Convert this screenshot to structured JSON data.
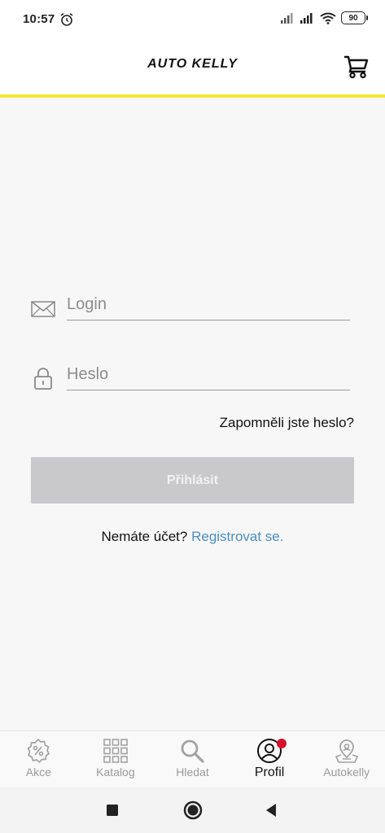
{
  "status_bar": {
    "time": "10:57",
    "battery": "90",
    "icons": [
      "alarm-icon",
      "signal-icon",
      "signal-icon",
      "wifi-icon",
      "battery-icon"
    ]
  },
  "header": {
    "brand": "AUTO KELLY",
    "cart_icon": "cart-icon",
    "accent_color": "#f4e92b"
  },
  "form": {
    "login_placeholder": "Login",
    "login_value": "",
    "password_placeholder": "Heslo",
    "password_value": "",
    "forgot_label": "Zapomněli jste heslo?",
    "submit_label": "Přihlásit",
    "no_account_text": "Nemáte účet?",
    "register_label": "Registrovat se."
  },
  "bottom_nav": {
    "items": [
      {
        "label": "Akce",
        "icon": "percent-badge-icon"
      },
      {
        "label": "Katalog",
        "icon": "grid-icon"
      },
      {
        "label": "Hledat",
        "icon": "search-icon"
      },
      {
        "label": "Profil",
        "icon": "profile-icon",
        "active": true
      },
      {
        "label": "Autokelly",
        "icon": "map-pin-icon"
      }
    ]
  },
  "colors": {
    "link": "#4a8ec0",
    "button_disabled": "#c9c9cb",
    "notification": "#d8102a"
  }
}
